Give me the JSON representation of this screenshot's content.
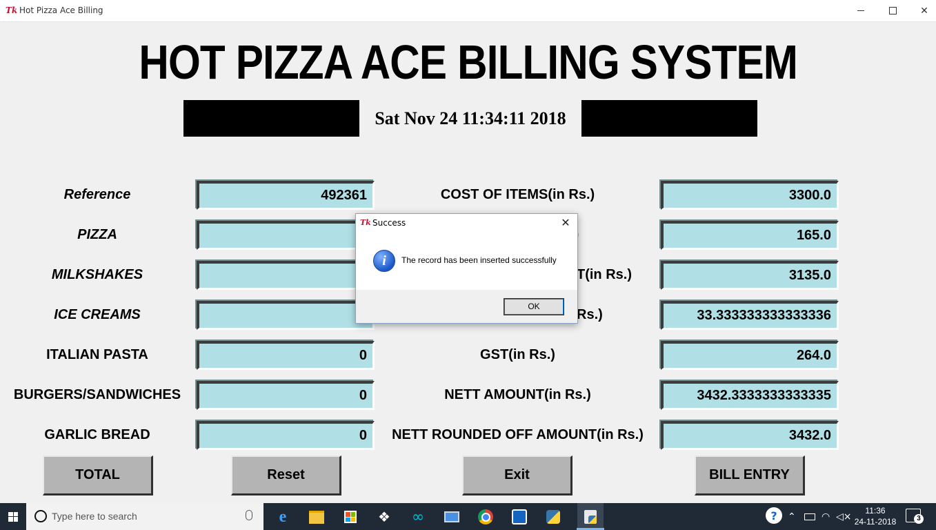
{
  "window": {
    "icon_text": "Tk",
    "title": "Hot Pizza Ace Billing",
    "minimize_icon": "minimize-icon",
    "maximize_icon": "maximize-icon",
    "close_symbol": "✕"
  },
  "header": {
    "title": "HOT PIZZA ACE BILLING SYSTEM",
    "datetime": "Sat Nov 24 11:34:11 2018"
  },
  "left_fields": [
    {
      "label": "Reference",
      "value": "492361",
      "italic": true
    },
    {
      "label": "PIZZA",
      "value": "",
      "italic": true
    },
    {
      "label": "MILKSHAKES",
      "value": "",
      "italic": true
    },
    {
      "label": "ICE CREAMS",
      "value": "",
      "italic": true
    },
    {
      "label": "ITALIAN PASTA",
      "value": "0",
      "italic": false
    },
    {
      "label": "BURGERS/SANDWICHES",
      "value": "0",
      "italic": false
    },
    {
      "label": "GARLIC BREAD",
      "value": "0",
      "italic": false
    }
  ],
  "right_fields": [
    {
      "label": "COST OF ITEMS(in Rs.)",
      "value": "3300.0"
    },
    {
      "label": "",
      "value": "165.0"
    },
    {
      "label": "",
      "value": "3135.0"
    },
    {
      "label": "",
      "value": "33.333333333333336"
    },
    {
      "label": "GST(in Rs.)",
      "value": "264.0"
    },
    {
      "label": "NETT AMOUNT(in Rs.)",
      "value": "3432.3333333333335"
    },
    {
      "label": "NETT ROUNDED OFF AMOUNT(in Rs.)",
      "value": "3432.0"
    }
  ],
  "partial_labels": {
    "row2": ")",
    "row3": "T(in Rs.)",
    "row4": "Rs.)"
  },
  "buttons": {
    "total": "TOTAL",
    "reset": "Reset",
    "exit": "Exit",
    "bill_entry": "BILL ENTRY"
  },
  "dialog": {
    "icon_text": "Tk",
    "title": "Success",
    "close_symbol": "✕",
    "info_glyph": "i",
    "message": "The record has been inserted successfully",
    "ok_label": "OK"
  },
  "taskbar": {
    "search_placeholder": "Type here to search",
    "time": "11:36",
    "date": "24-11-2018",
    "notification_count": "3",
    "apps": [
      "edge-icon",
      "file-explorer-icon",
      "store-icon",
      "dropbox-icon",
      "arduino-icon",
      "laptop-icon",
      "chrome-icon",
      "security-icon",
      "python-icon",
      "python-idle-icon"
    ]
  },
  "colors": {
    "background": "#f0f0f0",
    "entry_fill": "#b0e0e6",
    "button_fill": "#b4b4b4",
    "taskbar": "#202a36"
  }
}
